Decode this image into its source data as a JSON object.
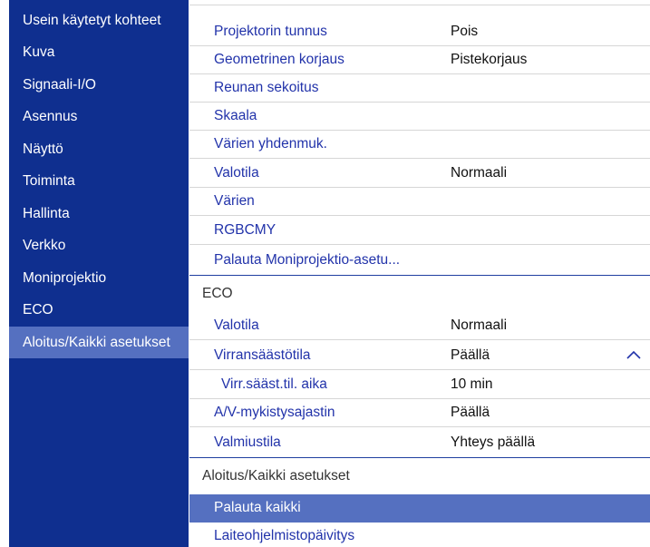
{
  "sidebar": {
    "items": [
      {
        "label": "Usein käytetyt kohteet"
      },
      {
        "label": "Kuva"
      },
      {
        "label": "Signaali-I/O"
      },
      {
        "label": "Asennus"
      },
      {
        "label": "Näyttö"
      },
      {
        "label": "Toiminta"
      },
      {
        "label": "Hallinta"
      },
      {
        "label": "Verkko"
      },
      {
        "label": "Moniprojektio"
      },
      {
        "label": "ECO"
      },
      {
        "label": "Aloitus/Kaikki asetukset"
      }
    ],
    "active_label": "Aloitus/Kaikki asetukset"
  },
  "main": {
    "multi_rows": [
      {
        "label": "Projektorin tunnus",
        "value": "Pois"
      },
      {
        "label": "Geometrinen korjaus",
        "value": "Pistekorjaus"
      },
      {
        "label": "Reunan sekoitus",
        "value": ""
      },
      {
        "label": "Skaala",
        "value": ""
      },
      {
        "label": "Värien yhdenmuk.",
        "value": ""
      },
      {
        "label": "Valotila",
        "value": "Normaali"
      },
      {
        "label": "Värien",
        "value": ""
      },
      {
        "label": "RGBCMY",
        "value": ""
      },
      {
        "label": "Palauta Moniprojektio-asetu...",
        "value": ""
      }
    ],
    "eco_section": {
      "title": "ECO",
      "rows": [
        {
          "label": "Valotila",
          "value": "Normaali"
        },
        {
          "label": "Virransäästötila",
          "value": "Päällä"
        },
        {
          "label": "Virr.sääst.til. aika",
          "value": "10 min"
        },
        {
          "label": "A/V-mykistysajastin",
          "value": "Päällä"
        },
        {
          "label": "Valmiustila",
          "value": "Yhteys päällä"
        }
      ]
    },
    "init_section": {
      "title": "Aloitus/Kaikki asetukset",
      "rows": [
        {
          "label": "Palauta kaikki",
          "value": ""
        },
        {
          "label": "Laiteohjelmistopäivitys",
          "value": ""
        }
      ]
    },
    "scroll_icon": "chevron-up-icon"
  },
  "colors": {
    "sidebar_bg": "#0f2f8f",
    "highlight": "#5570c0",
    "link_text": "#2233aa"
  }
}
